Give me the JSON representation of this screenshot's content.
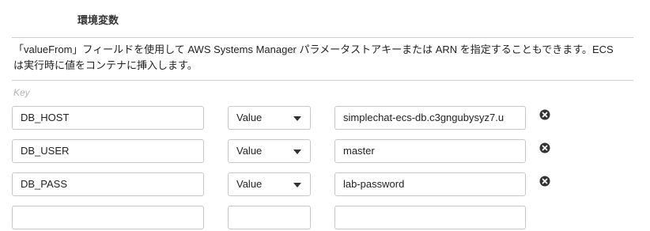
{
  "section": {
    "title": "環境変数",
    "description": "「valueFrom」フィールドを使用して AWS Systems Manager パラメータストアキーまたは ARN を指定することもできます。ECS は実行時に値をコンテナに挿入します。",
    "key_label": "Key"
  },
  "env_vars": [
    {
      "key": "DB_HOST",
      "type": "Value",
      "value": "simplechat-ecs-db.c3gngubysyz7.u",
      "remove_icon": "close-circle-icon"
    },
    {
      "key": "DB_USER",
      "type": "Value",
      "value": "master",
      "remove_icon": "close-circle-icon"
    },
    {
      "key": "DB_PASS",
      "type": "Value",
      "value": "lab-password",
      "remove_icon": "close-circle-icon"
    }
  ],
  "colors": {
    "border": "#c6c6c6",
    "rule": "#cfcfcf",
    "placeholder": "#b3b3b3"
  }
}
